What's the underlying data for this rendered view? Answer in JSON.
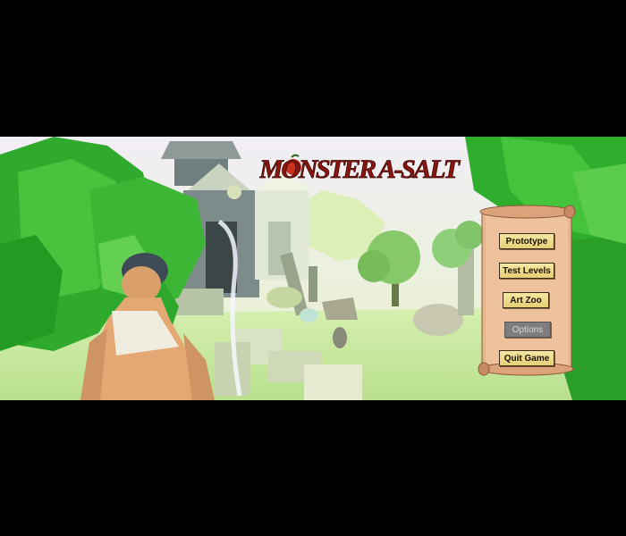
{
  "game": {
    "title": "MONSTER A-SALT"
  },
  "menu": {
    "buttons": [
      {
        "label": "Prototype",
        "state": "normal"
      },
      {
        "label": "Test Levels",
        "state": "normal"
      },
      {
        "label": "Art Zoo",
        "state": "normal"
      },
      {
        "label": "Options",
        "state": "disabled"
      },
      {
        "label": "Quit Game",
        "state": "normal"
      }
    ]
  },
  "colors": {
    "letterbox": "#000000",
    "foliage": "#3cbf3a",
    "sky": "#eef6d8",
    "title_red": "#8a1410",
    "button_gold": "#eedb88",
    "scroll_parchment": "#e8b68e"
  }
}
